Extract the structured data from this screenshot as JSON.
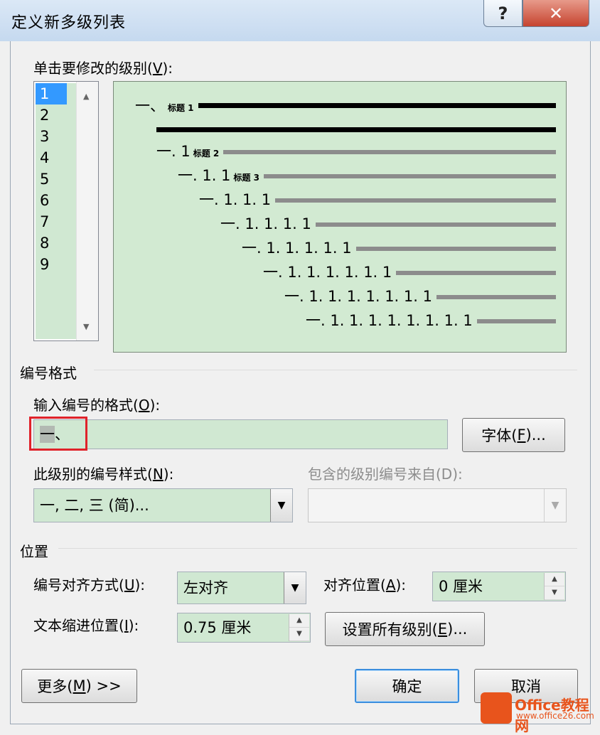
{
  "window": {
    "title": "定义新多级列表",
    "help_label": "?",
    "close_label": "✕"
  },
  "level_list": {
    "label_prefix": "单击要修改的级别(",
    "label_key": "V",
    "label_suffix": "):",
    "items": [
      "1",
      "2",
      "3",
      "4",
      "5",
      "6",
      "7",
      "8",
      "9"
    ],
    "selected": "1"
  },
  "preview": {
    "lines": [
      {
        "number": "一、",
        "tag": "标题 1"
      },
      {
        "number": "",
        "tag": ""
      },
      {
        "number": "一. 1",
        "tag": "标题 2"
      },
      {
        "number": "一. 1. 1",
        "tag": "标题 3"
      },
      {
        "number": "一. 1. 1. 1",
        "tag": ""
      },
      {
        "number": "一. 1. 1. 1. 1",
        "tag": ""
      },
      {
        "number": "一. 1. 1. 1. 1. 1",
        "tag": ""
      },
      {
        "number": "一. 1. 1. 1. 1. 1. 1",
        "tag": ""
      },
      {
        "number": "一. 1. 1. 1. 1. 1. 1. 1",
        "tag": ""
      },
      {
        "number": "一. 1. 1. 1. 1. 1. 1. 1. 1",
        "tag": ""
      }
    ]
  },
  "number_format": {
    "section": "编号格式",
    "input_label_prefix": "输入编号的格式(",
    "input_label_key": "O",
    "input_label_suffix": "):",
    "format_highlight": "一",
    "format_rest": "、",
    "font_button": {
      "prefix": "字体(",
      "key": "F",
      "suffix": ")..."
    },
    "style_label_prefix": "此级别的编号样式(",
    "style_label_key": "N",
    "style_label_suffix": "):",
    "style_value": "一, 二, 三 (简)...",
    "include_label": "包含的级别编号来自(D):",
    "include_value": ""
  },
  "position": {
    "section": "位置",
    "align_label_prefix": "编号对齐方式(",
    "align_label_key": "U",
    "align_label_suffix": "):",
    "align_value": "左对齐",
    "align_at_prefix": "对齐位置(",
    "align_at_key": "A",
    "align_at_suffix": "):",
    "align_at_value": "0 厘米",
    "indent_prefix": "文本缩进位置(",
    "indent_key": "I",
    "indent_suffix": "):",
    "indent_value": "0.75 厘米",
    "set_all": {
      "prefix": "设置所有级别(",
      "key": "E",
      "suffix": ")..."
    }
  },
  "buttons": {
    "more": {
      "prefix": "更多(",
      "key": "M",
      "suffix": ") >>"
    },
    "ok": "确定",
    "cancel": "取消"
  },
  "watermark": {
    "brand": "Office教程网",
    "url": "www.office26.com"
  }
}
